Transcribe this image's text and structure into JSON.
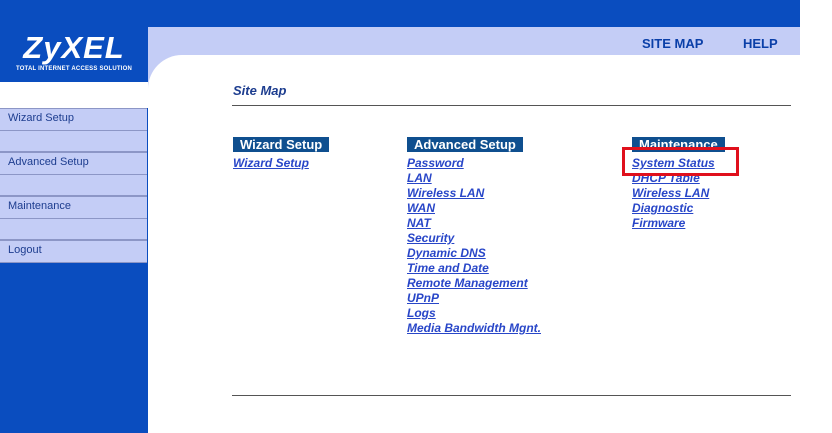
{
  "logo": {
    "brand": "ZyXEL",
    "tagline": "TOTAL INTERNET ACCESS SOLUTION"
  },
  "header": {
    "site_map_link": "SITE MAP",
    "help_link": "HELP"
  },
  "sidebar": {
    "items": [
      {
        "label": "Wizard Setup"
      },
      {
        "label": "Advanced Setup"
      },
      {
        "label": "Maintenance"
      },
      {
        "label": "Logout"
      }
    ]
  },
  "main": {
    "title": "Site Map",
    "columns": [
      {
        "heading": "Wizard Setup",
        "links": [
          "Wizard Setup"
        ]
      },
      {
        "heading": "Advanced Setup",
        "links": [
          "Password",
          "LAN",
          "Wireless LAN",
          "WAN",
          "NAT",
          "Security",
          "Dynamic DNS",
          "Time and Date",
          "Remote Management",
          "UPnP",
          "Logs",
          "Media Bandwidth Mgnt."
        ]
      },
      {
        "heading": "Maintenance",
        "links": [
          "System Status",
          "DHCP Table",
          "Wireless LAN",
          "Diagnostic",
          "Firmware"
        ]
      }
    ]
  },
  "colors": {
    "nav_blue": "#0a4dbf",
    "band_light": "#c4cdf6",
    "link": "#2846c8",
    "highlight": "#e0101c"
  }
}
